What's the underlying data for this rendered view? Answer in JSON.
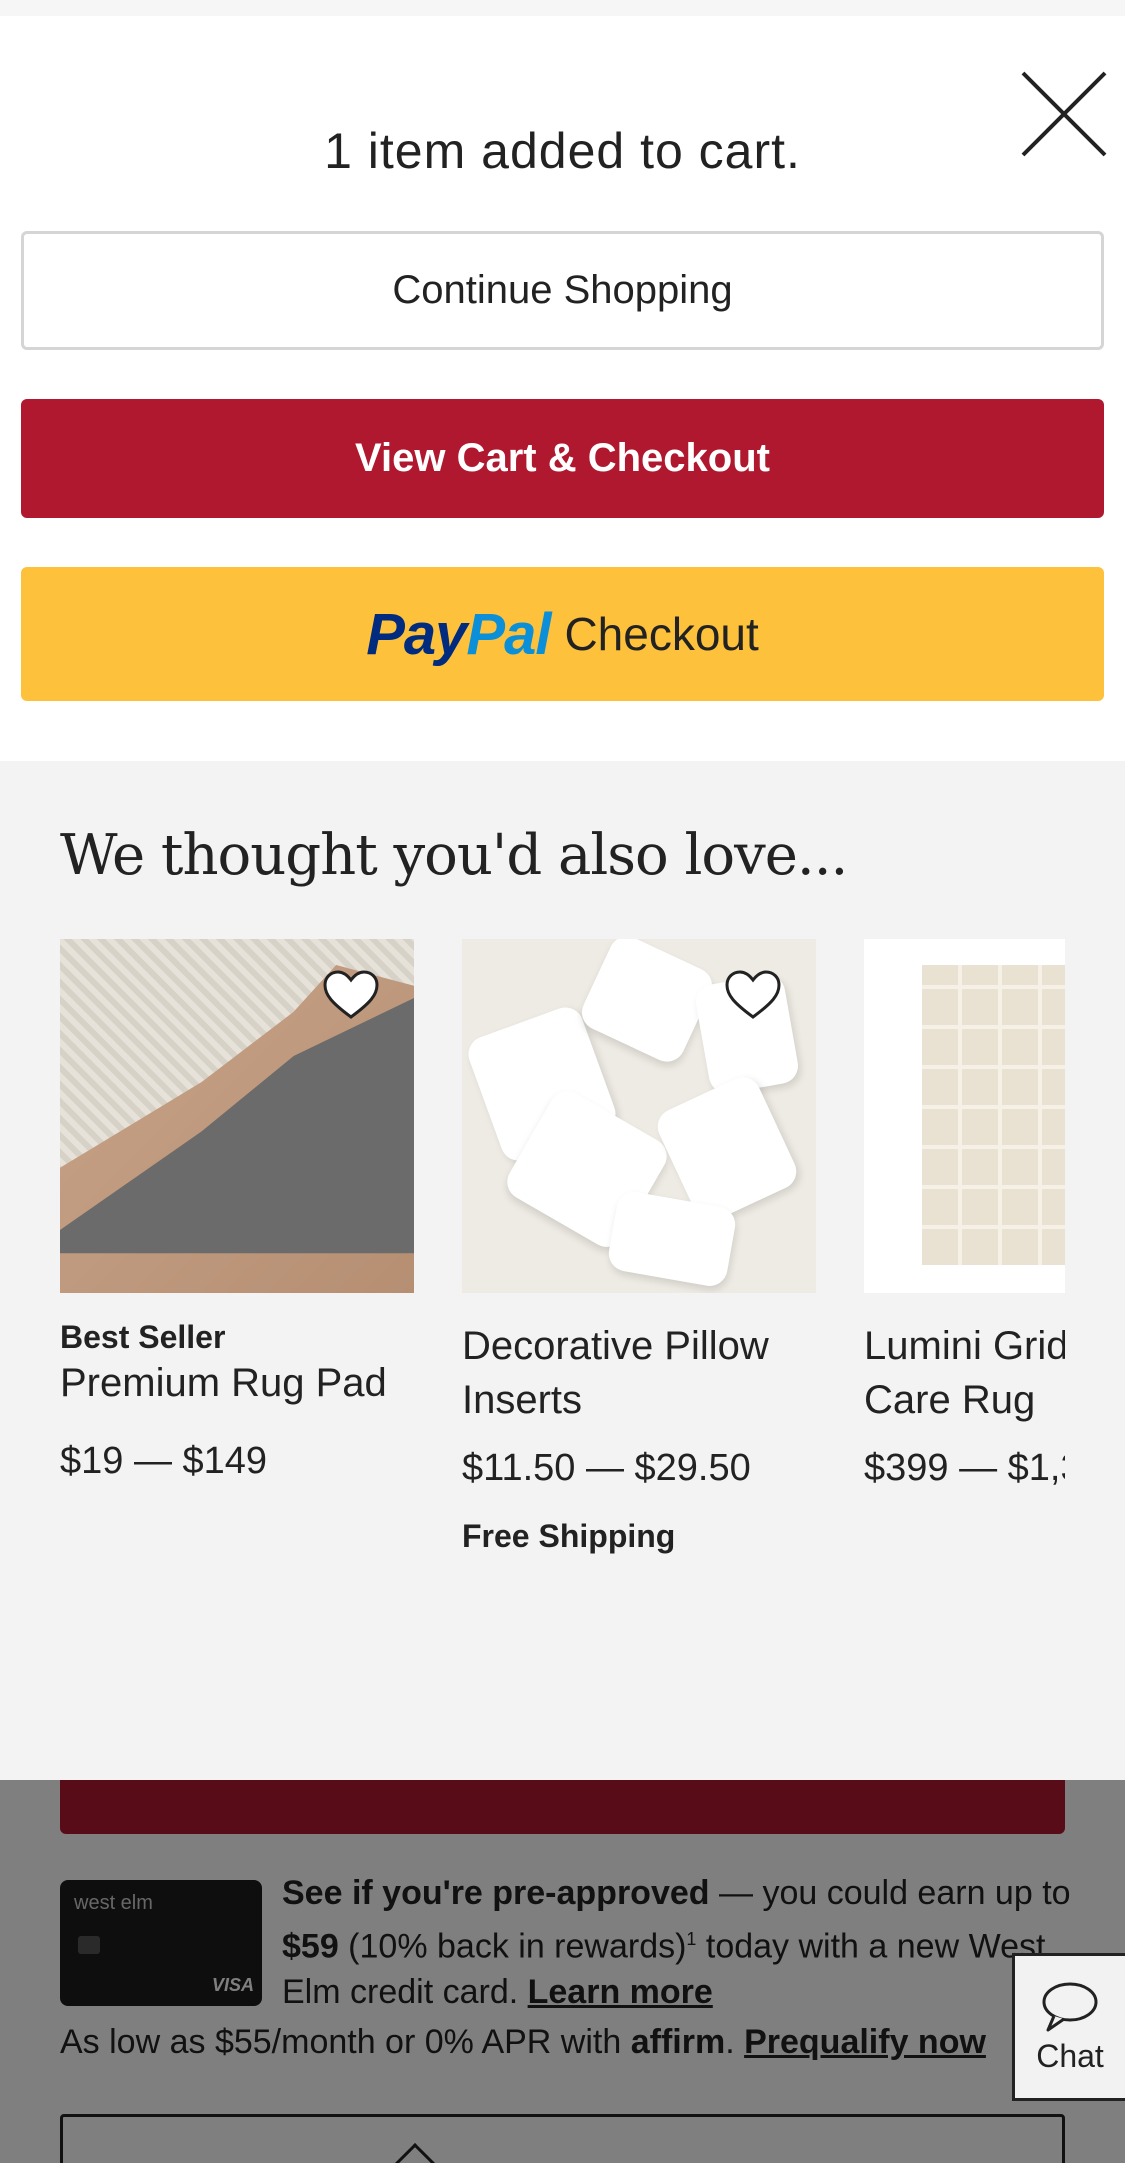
{
  "modal": {
    "title": "1 item added to cart.",
    "continue_label": "Continue Shopping",
    "view_cart_label": "View Cart & Checkout",
    "paypal": {
      "pay": "Pay",
      "pal": "Pal",
      "checkout": "Checkout"
    }
  },
  "recommendations": {
    "heading": "We thought you'd also love...",
    "products": [
      {
        "badge": "Best Seller",
        "name": "Premium Rug Pad",
        "price": "$19 — $149",
        "shipping": ""
      },
      {
        "badge": "",
        "name": "Decorative Pillow Inserts",
        "price": "$11.50 — $29.50",
        "shipping": "Free Shipping"
      },
      {
        "badge": "",
        "name": "Lumini Grid Care Rug",
        "price": "$399 — $1,3",
        "shipping": ""
      }
    ]
  },
  "background": {
    "card_brand": "west elm",
    "card_network": "VISA",
    "promo": {
      "bold_lead": "See if you're pre-approved",
      "text1": " — you could earn up to ",
      "bold_amount": "$59",
      "text2": " (10% back in rewards)",
      "sup": "1",
      "text3": " today with a new West Elm credit card. ",
      "link": "Learn more"
    },
    "affirm": {
      "text": "As low as $55/month or 0% APR with ",
      "brand": "affirm",
      "sep": ". ",
      "link": "Prequalify now"
    }
  },
  "chat": {
    "label": "Chat"
  },
  "colors": {
    "accent_red": "#b0182f",
    "paypal_yellow": "#fdc13c",
    "paypal_navy": "#002b7f",
    "paypal_blue": "#0a8fd8"
  }
}
